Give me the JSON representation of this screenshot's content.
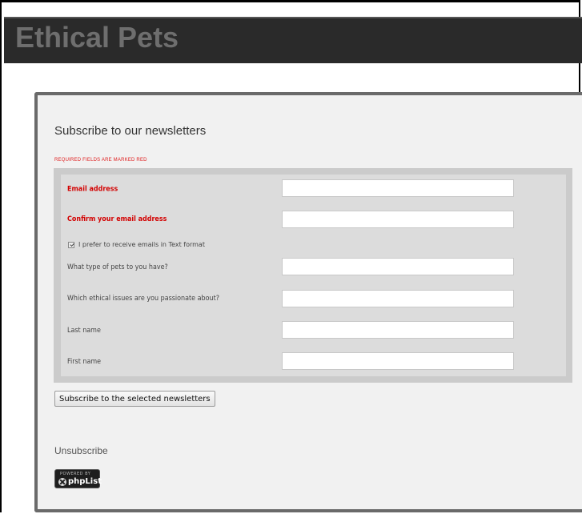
{
  "header": {
    "site_title": "Ethical Pets"
  },
  "form": {
    "heading": "Subscribe to our newsletters",
    "required_note": "REQUIRED FIELDS ARE MARKED RED",
    "fields": [
      {
        "label": "Email address",
        "value": "",
        "required": true
      },
      {
        "label": "Confirm your email address",
        "value": "",
        "required": true
      },
      {
        "label": "What type of pets to you have?",
        "value": "",
        "required": false
      },
      {
        "label": "Which ethical issues are you passionate about?",
        "value": "",
        "required": false
      },
      {
        "label": "Last name",
        "value": "",
        "required": false
      },
      {
        "label": "First name",
        "value": "",
        "required": false
      }
    ],
    "text_format_checkbox": {
      "label": "I prefer to receive emails in Text format",
      "checked": true
    },
    "submit_label": "Subscribe to the selected newsletters"
  },
  "unsubscribe_label": "Unsubscribe",
  "badge": {
    "powered_by": "POWERED BY",
    "name": "phpList"
  },
  "colors": {
    "header_bg": "#2a2a2a",
    "required_red": "#d30000",
    "card_border": "#6a6a6a"
  }
}
